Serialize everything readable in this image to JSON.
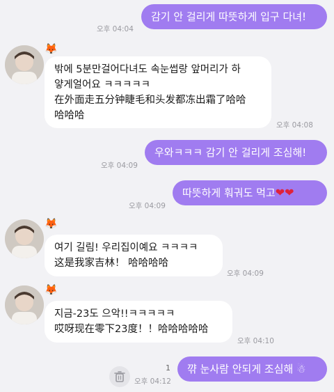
{
  "messages": {
    "m1": {
      "text": "감기 안 걸리게 따뜻하게 입구 다녀!",
      "time": "오후 04:04"
    },
    "m2": {
      "lines": [
        "밖에 5분만걸어다녀도 속눈썹랑 앞머리가 하",
        "얗게얼어요 ㅋㅋㅋㅋㅋ",
        "在外面走五分钟睫毛和头发都冻出霜了哈哈",
        "哈哈哈"
      ],
      "time": "오후 04:08"
    },
    "m3": {
      "text": "우와ㅋㅋㅋ 감기 안 걸리게 조심해!",
      "time": "오후 04:09"
    },
    "m4": {
      "text": "따뜻하게 훠궈도 먹고",
      "hearts": "❤❤",
      "time": "오후 04:09"
    },
    "m5": {
      "lines": [
        "여기 길림! 우리집이예요 ㅋㅋㅋㅋ",
        "这是我家吉林！ 哈哈哈哈"
      ],
      "time": "오후 04:09"
    },
    "m6": {
      "lines": [
        "지금-23도 으악!!ㅋㅋㅋㅋㅋ",
        "哎呀现在零下23度！！哈哈哈哈哈"
      ],
      "time": "오후 04:10"
    },
    "m7": {
      "text": "꺆 눈사람 안되게 조심해",
      "emoji": "☃",
      "time": "오후 04:12",
      "unread": "1"
    }
  },
  "icons": {
    "profile_badge": "fox-emoji",
    "delete": "trash-icon"
  },
  "colors": {
    "outgoing_bubble": "#a07cf0",
    "incoming_bubble": "#ffffff",
    "background": "#f2f2f5"
  }
}
